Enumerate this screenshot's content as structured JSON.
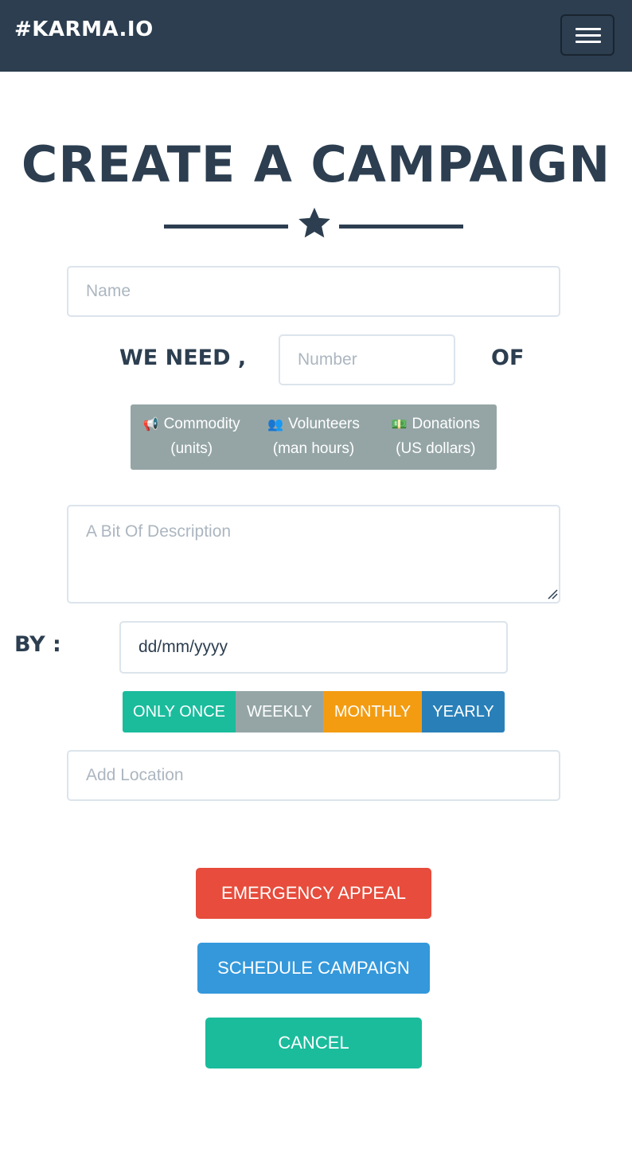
{
  "navbar": {
    "brand": "#KARMA.IO",
    "menu_icon": "hamburger-icon"
  },
  "page": {
    "title": "CREATE A CAMPAIGN",
    "divider_icon": "star-icon"
  },
  "form": {
    "name_placeholder": "Name",
    "we_need_label": "WE NEED ,",
    "number_placeholder": "Number",
    "of_label": "OF",
    "types": [
      {
        "icon": "megaphone-icon",
        "glyph": "📢",
        "line1": "Commodity",
        "line2": "(units)"
      },
      {
        "icon": "users-icon",
        "glyph": "👥",
        "line1": "Volunteers",
        "line2": "(man hours)"
      },
      {
        "icon": "money-icon",
        "glyph": "💵",
        "line1": "Donations",
        "line2": "(US dollars)"
      }
    ],
    "description_placeholder": "A Bit Of Description",
    "by_label": "BY :",
    "date_value": "dd/mm/yyyy",
    "frequency": [
      {
        "label": "ONLY ONCE",
        "color": "#1abc9c"
      },
      {
        "label": "WEEKLY",
        "color": "#95a5a6"
      },
      {
        "label": "MONTHLY",
        "color": "#f39c12"
      },
      {
        "label": "YEARLY",
        "color": "#2980b9"
      }
    ],
    "location_placeholder": "Add Location"
  },
  "actions": {
    "emergency": {
      "label": "EMERGENCY APPEAL",
      "color": "#e74c3c"
    },
    "schedule": {
      "label": "SCHEDULE CAMPAIGN",
      "color": "#3498db"
    },
    "cancel": {
      "label": "CANCEL",
      "color": "#1abc9c"
    }
  },
  "colors": {
    "primary": "#2c3e50",
    "input_border": "#dce4ec",
    "placeholder": "#acb6c0"
  }
}
